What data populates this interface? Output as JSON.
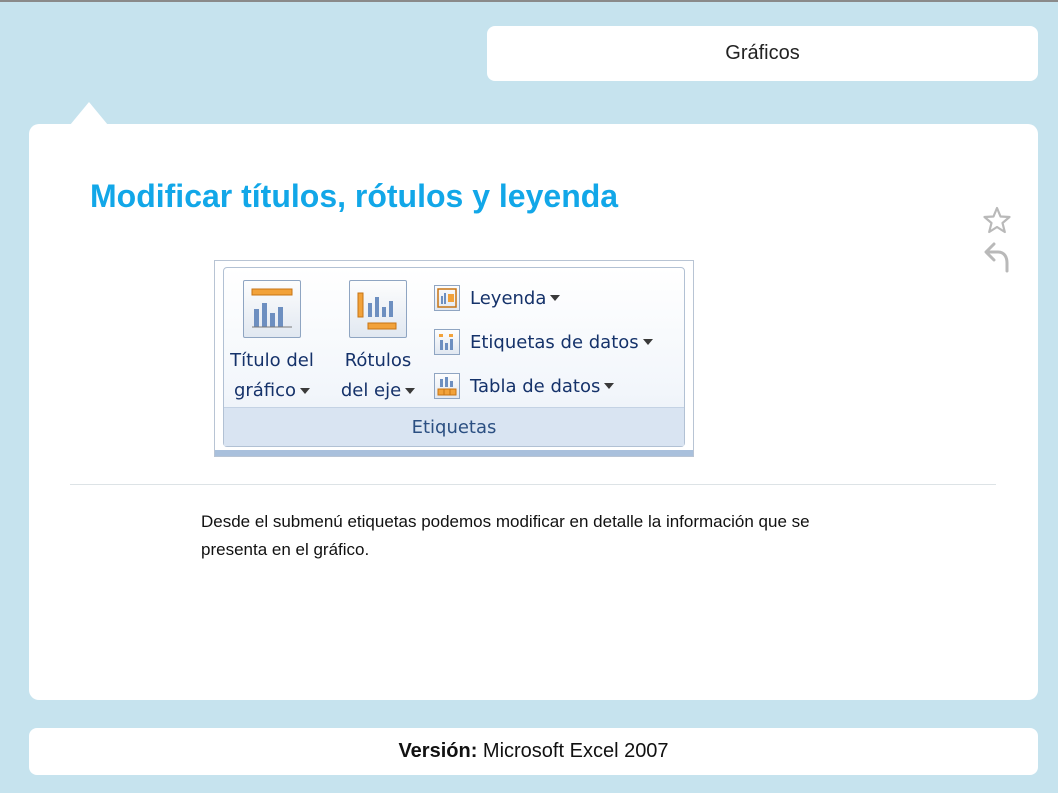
{
  "header": {
    "section_tab": "Gráficos"
  },
  "card": {
    "title": "Modificar títulos, rótulos y leyenda",
    "description": "Desde el submenú etiquetas podemos modificar en detalle la información que se presenta en el gráfico."
  },
  "ribbon": {
    "chart_title_line1": "Título del",
    "chart_title_line2": "gráfico",
    "axis_titles_line1": "Rótulos",
    "axis_titles_line2": "del eje",
    "legend": "Leyenda",
    "data_labels": "Etiquetas de datos",
    "data_table": "Tabla de datos",
    "group_label": "Etiquetas"
  },
  "footer": {
    "version_label": "Versión:",
    "version_value": "Microsoft Excel 2007"
  },
  "icons": {
    "favorite": "star-icon",
    "back": "undo-icon"
  },
  "colors": {
    "background": "#c6e3ee",
    "title": "#12a7e8",
    "ribbon_text": "#15326a"
  }
}
